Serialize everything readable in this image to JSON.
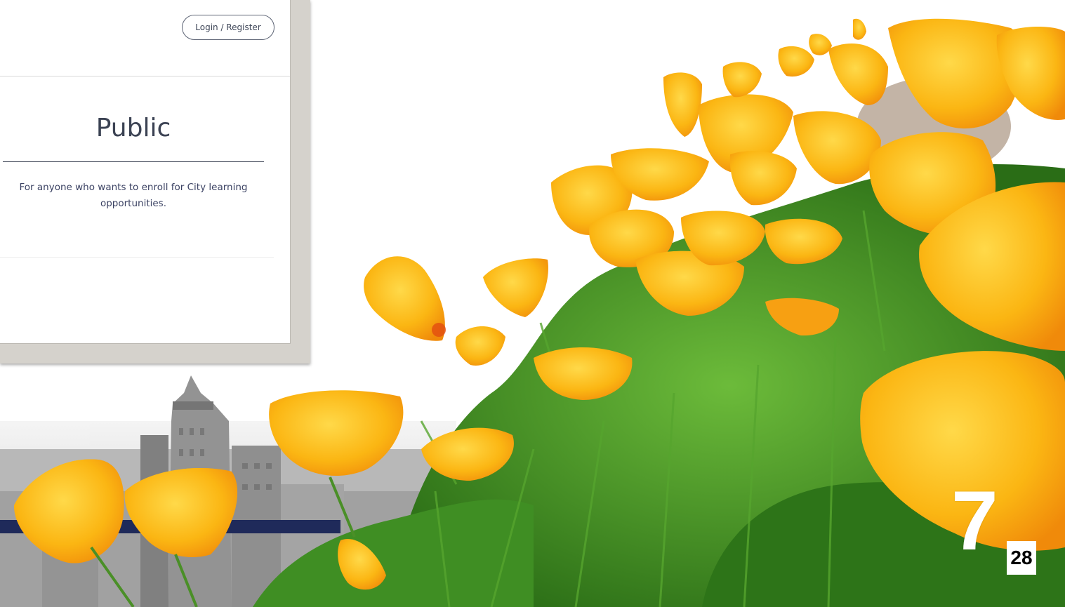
{
  "screenshot": {
    "login_label": "Login / Register",
    "card": {
      "title": "Public",
      "description": "For anyone who wants to enroll for City learning opportunities."
    }
  },
  "slide": {
    "big_number": "7",
    "page_number": "28"
  },
  "colors": {
    "navy_band": "#1f2a5a",
    "poppy_orange": "#fbb613",
    "foliage_green": "#3d8a22"
  }
}
